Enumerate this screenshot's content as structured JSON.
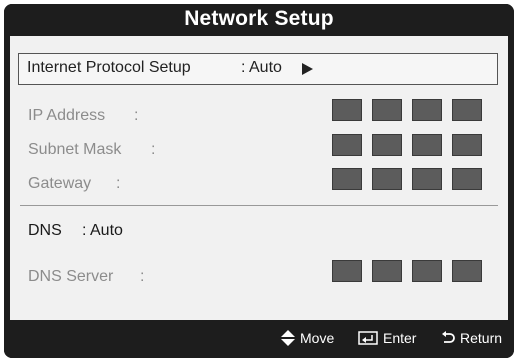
{
  "dialog": {
    "title": "Network Setup"
  },
  "protocol": {
    "label": "Internet Protocol Setup",
    "value": ": Auto"
  },
  "fields": [
    {
      "label": "IP Address",
      "colon": ":"
    },
    {
      "label": "Subnet Mask",
      "colon": ":"
    },
    {
      "label": "Gateway",
      "colon": ":"
    }
  ],
  "dns": {
    "label": "DNS",
    "value": ": Auto",
    "server_label": "DNS Server",
    "server_colon": ":"
  },
  "footer": {
    "move": "Move",
    "enter": "Enter",
    "return": "Return"
  },
  "colors": {
    "background": "#1d1d1d",
    "panel": "#f1f1f1",
    "box": "#5c5c5c",
    "disabled_text": "#8c8c8c"
  }
}
